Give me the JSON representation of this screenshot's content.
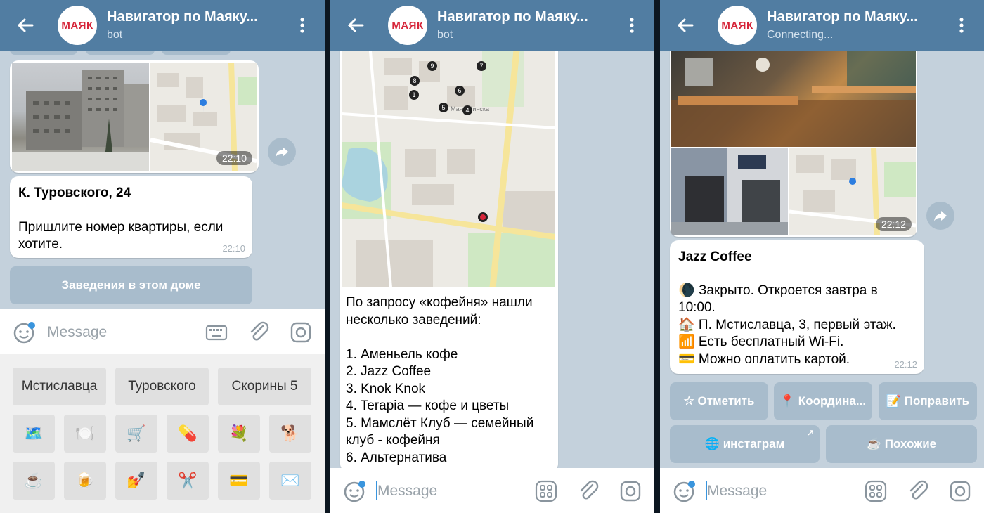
{
  "colors": {
    "header": "#517da2",
    "chat_bg": "#c4d1dc",
    "bot_button": "#a8bccc",
    "accent_red": "#d6263a"
  },
  "screens": [
    {
      "header": {
        "title": "Навигатор по Маяку...",
        "subtitle": "bot",
        "avatar_text": "МАЯК"
      },
      "photo_time": "22:10",
      "card": {
        "title": "К. Туровского, 24",
        "text_line1": "Пришлите номер квартиры, если",
        "text_line2": "хотите.",
        "time": "22:10"
      },
      "inline_button": "Заведения в этом доме",
      "input_placeholder": "Message",
      "reply_keyboard": {
        "row1": [
          "Мстиславца",
          "Туровского",
          "Скорины 5"
        ],
        "row2": [
          "🗺️",
          "🍽️",
          "🛒",
          "💊",
          "💐",
          "🐕"
        ],
        "row3": [
          "☕",
          "🍺",
          "💅",
          "✂️",
          "💳",
          "✉️"
        ]
      }
    },
    {
      "header": {
        "title": "Навигатор по Маяку...",
        "subtitle": "bot",
        "avatar_text": "МАЯК"
      },
      "map_markers": [
        "9",
        "7",
        "8",
        "6",
        "1",
        "5",
        "4"
      ],
      "map_label": "Маяк Минска",
      "message_lines": [
        "По запросу «кофейня» нашли",
        "несколько заведений:",
        "",
        "1. Аменьель кофе",
        "2. Jazz Coffee",
        "3. Knok Knok",
        "4. Terapia — кофе и цветы",
        "5. Мамслёт Клуб — семейный",
        "клуб - кофейня",
        "6. Альтернатива"
      ],
      "input_placeholder": "Message"
    },
    {
      "header": {
        "title": "Навигатор по Маяку...",
        "subtitle": "Connecting...",
        "avatar_text": "МАЯК"
      },
      "photo_time": "22:12",
      "card": {
        "title": "Jazz Coffee",
        "line1": "🌘 Закрыто. Откроется завтра в",
        "line2": "10:00.",
        "line3": "🏠 П. Мстиславца, 3, первый этаж.",
        "line4": "📶 Есть бесплатный Wi-Fi.",
        "line5": "💳 Можно оплатить картой.",
        "time": "22:12"
      },
      "buttons_row1": [
        "☆ Отметить",
        "📍 Координа...",
        "📝 Поправить"
      ],
      "buttons_row2": [
        "🌐 инстаграм",
        "☕ Похожие"
      ],
      "input_placeholder": "Message"
    }
  ]
}
